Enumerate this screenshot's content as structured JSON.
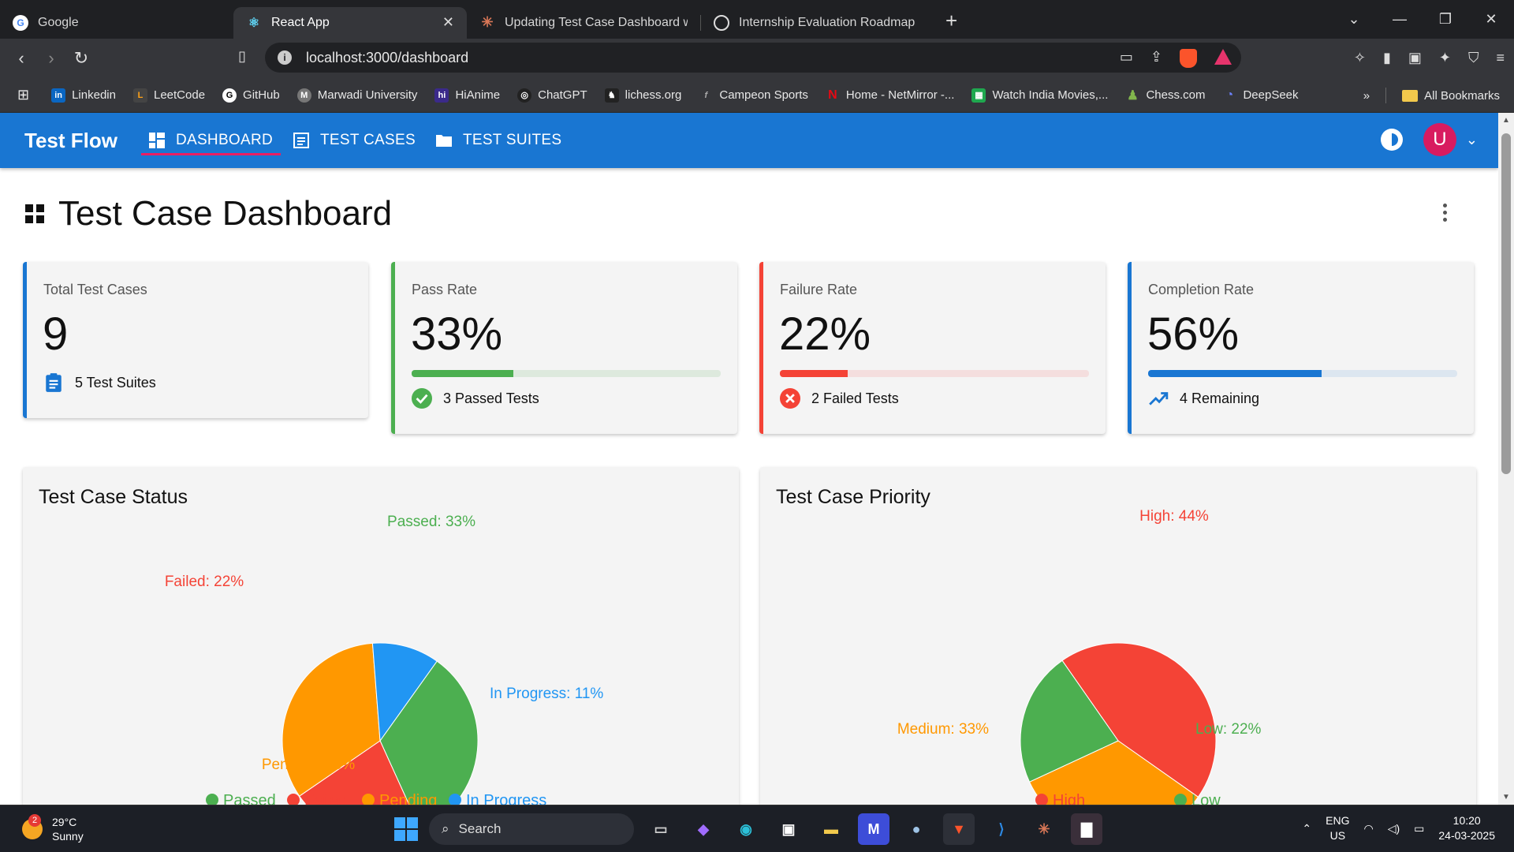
{
  "browser": {
    "tabs": [
      {
        "title": "Google",
        "icon": "google-icon",
        "active": false
      },
      {
        "title": "React App",
        "icon": "react-icon",
        "active": true
      },
      {
        "title": "Updating Test Case Dashboard with",
        "icon": "claude-icon",
        "active": false
      },
      {
        "title": "Internship Evaluation Roadmap",
        "icon": "chatgpt-icon",
        "active": false
      }
    ],
    "url": "localhost:3000/dashboard",
    "bookmarks": [
      {
        "label": "Linkedin",
        "color": "#0a66c2",
        "glyph": "in"
      },
      {
        "label": "LeetCode",
        "color": "#444",
        "glyph": "L"
      },
      {
        "label": "GitHub",
        "color": "#24292e",
        "glyph": "G"
      },
      {
        "label": "Marwadi University",
        "color": "#666",
        "glyph": "M"
      },
      {
        "label": "HiAnime",
        "color": "#3b2a8a",
        "glyph": "hi"
      },
      {
        "label": "ChatGPT",
        "color": "#333",
        "glyph": "◎"
      },
      {
        "label": "lichess.org",
        "color": "#333",
        "glyph": "♞"
      },
      {
        "label": "Campeon Sports",
        "color": "#333",
        "glyph": "f"
      },
      {
        "label": "Home - NetMirror -...",
        "color": "#e50914",
        "glyph": "N"
      },
      {
        "label": "Watch India Movies,...",
        "color": "#1fa84f",
        "glyph": "▦"
      },
      {
        "label": "Chess.com",
        "color": "#81b64c",
        "glyph": "♟"
      },
      {
        "label": "DeepSeek",
        "color": "#4d6bfe",
        "glyph": "◔"
      }
    ],
    "all_bookmarks": "All Bookmarks"
  },
  "app": {
    "brand": "Test Flow",
    "nav": [
      "DASHBOARD",
      "TEST CASES",
      "TEST SUITES"
    ],
    "avatar_letter": "U"
  },
  "page": {
    "title": "Test Case Dashboard"
  },
  "cards": [
    {
      "label": "Total Test Cases",
      "value": "9",
      "foot": "5 Test Suites",
      "color": "#1976d2"
    },
    {
      "label": "Pass Rate",
      "value": "33%",
      "foot": "3 Passed Tests",
      "color": "#4caf50",
      "progress": 0.33,
      "track": "#dde9dd"
    },
    {
      "label": "Failure Rate",
      "value": "22%",
      "foot": "2 Failed Tests",
      "color": "#f44336",
      "progress": 0.22,
      "track": "#f4dede"
    },
    {
      "label": "Completion Rate",
      "value": "56%",
      "foot": "4 Remaining",
      "color": "#1976d2",
      "progress": 0.56,
      "track": "#dce6f0"
    }
  ],
  "chart_data": [
    {
      "type": "pie",
      "title": "Test Case Status",
      "categories": [
        "Passed",
        "Failed",
        "Pending",
        "In Progress"
      ],
      "values": [
        33,
        22,
        33,
        11
      ],
      "labels": [
        "Passed: 33%",
        "Failed: 22%",
        "Pending: 33%",
        "In Progress: 11%"
      ],
      "colors": [
        "#4caf50",
        "#f44336",
        "#ff9800",
        "#2196f3"
      ],
      "legend": "bottom"
    },
    {
      "type": "pie",
      "title": "Test Case Priority",
      "categories": [
        "High",
        "Medium",
        "Low"
      ],
      "values": [
        44,
        33,
        22
      ],
      "labels": [
        "High: 44%",
        "Medium: 33%",
        "Low: 22%"
      ],
      "colors": [
        "#f44336",
        "#ff9800",
        "#4caf50"
      ],
      "legend": "bottom"
    }
  ],
  "taskbar": {
    "weather_temp": "29°C",
    "weather_desc": "Sunny",
    "weather_badge": "2",
    "search": "Search",
    "lang1": "ENG",
    "lang2": "US",
    "time": "10:20",
    "date": "24-03-2025"
  }
}
